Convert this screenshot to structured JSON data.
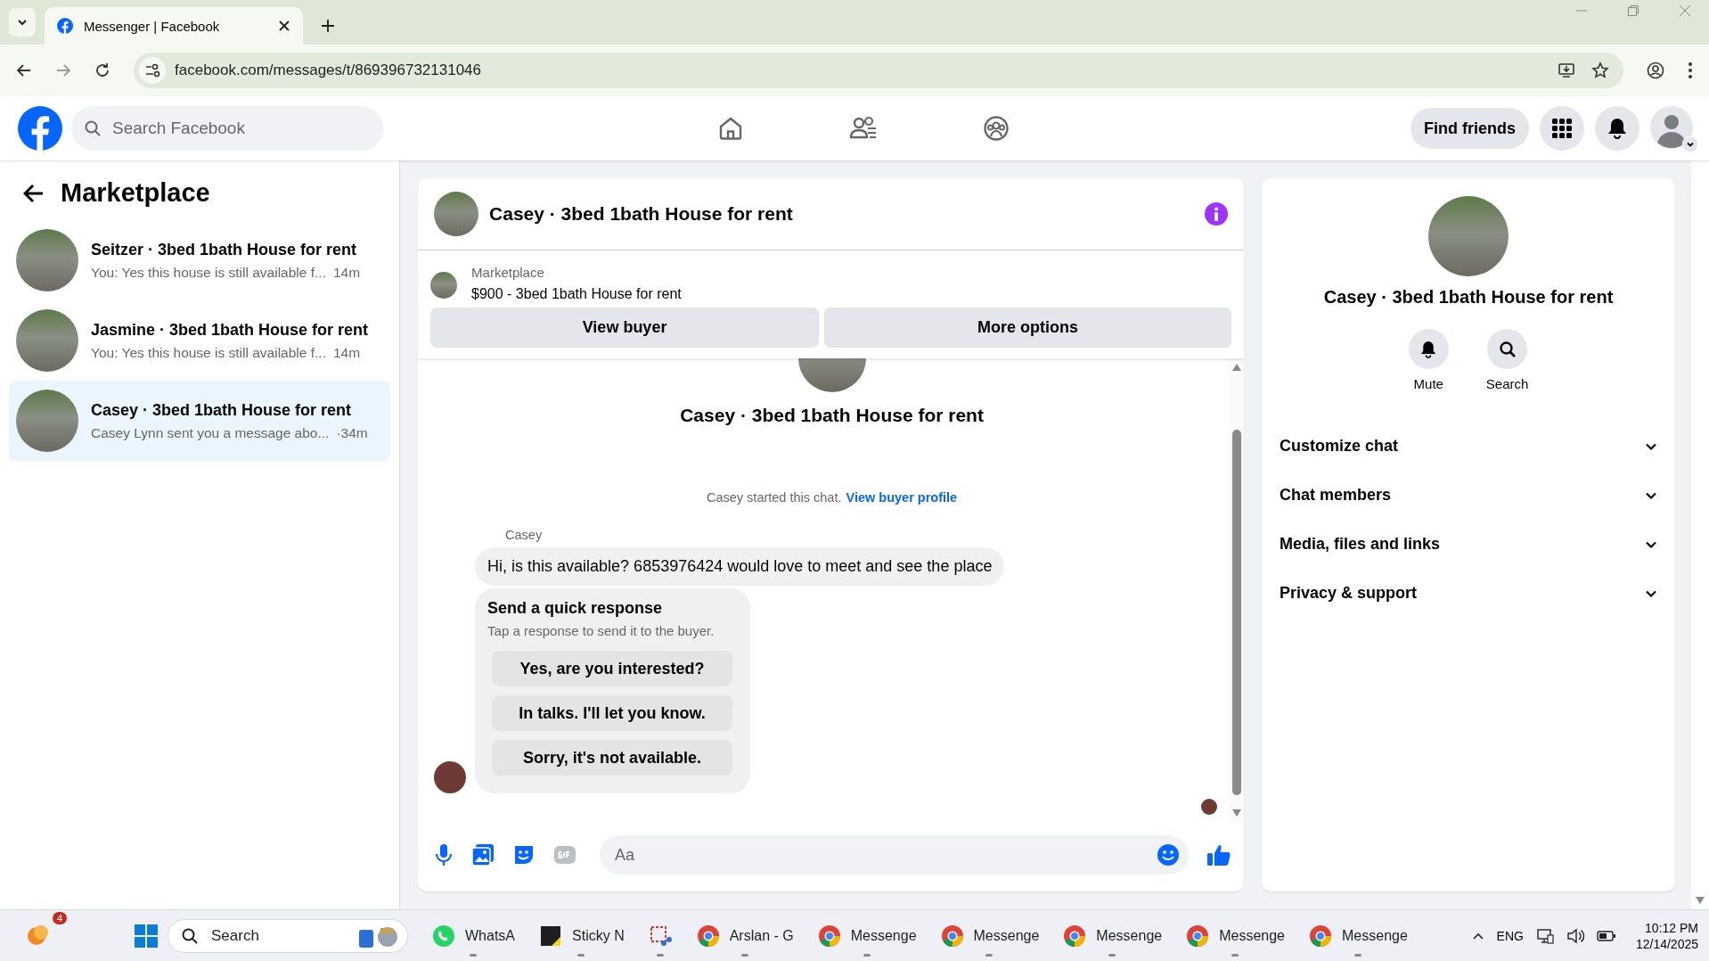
{
  "browser": {
    "tab_title": "Messenger | Facebook",
    "url": "facebook.com/messages/t/869396732131046"
  },
  "header": {
    "search_placeholder": "Search Facebook",
    "find_friends": "Find friends"
  },
  "sidebar": {
    "title": "Marketplace",
    "conversations": [
      {
        "name": "Seitzer · 3bed 1bath House for rent",
        "preview": "You: Yes this house is still available f...",
        "time": "14m",
        "selected": false
      },
      {
        "name": "Jasmine · 3bed 1bath House for rent",
        "preview": "You: Yes this house is still available f...",
        "time": "14m",
        "selected": false
      },
      {
        "name": "Casey · 3bed 1bath House for rent",
        "preview": "Casey Lynn sent you a message abo...",
        "time": "·34m",
        "selected": true
      }
    ]
  },
  "chat": {
    "title": "Casey · 3bed 1bath House for rent",
    "listing": {
      "label": "Marketplace",
      "title": "$900 - 3bed 1bath House for rent"
    },
    "buttons": [
      "View buyer",
      "More options"
    ],
    "intro_title": "Casey · 3bed 1bath House for rent",
    "system_text": "Casey started this chat.",
    "system_link": "View buyer profile",
    "sender": "Casey",
    "message": "Hi, is this available? 6853976424 would love to meet and see the place",
    "quick": {
      "title": "Send a quick response",
      "subtitle": "Tap a response to send it to the buyer.",
      "options": [
        "Yes, are you interested?",
        "In talks. I'll let you know.",
        "Sorry, it's not available."
      ]
    },
    "composer_placeholder": "Aa"
  },
  "details": {
    "title": "Casey · 3bed 1bath House for rent",
    "actions": [
      {
        "kind": "mute",
        "label": "Mute"
      },
      {
        "kind": "search",
        "label": "Search"
      }
    ],
    "sections": [
      "Customize chat",
      "Chat members",
      "Media, files and links",
      "Privacy & support"
    ]
  },
  "taskbar": {
    "badge": "4",
    "search_placeholder": "Search",
    "apps": [
      {
        "kind": "whatsapp",
        "label": "WhatsA"
      },
      {
        "kind": "sticky",
        "label": "Sticky N"
      },
      {
        "kind": "snip"
      },
      {
        "kind": "chrome",
        "label": "Arslan - G"
      },
      {
        "kind": "chrome",
        "label": "Messenge"
      },
      {
        "kind": "chrome",
        "label": "Messenge"
      },
      {
        "kind": "chrome",
        "label": "Messenge"
      },
      {
        "kind": "chrome",
        "label": "Messenge"
      },
      {
        "kind": "chrome",
        "label": "Messenge"
      }
    ],
    "language": "ENG",
    "time": "10:12 PM",
    "date": "12/14/2025"
  }
}
